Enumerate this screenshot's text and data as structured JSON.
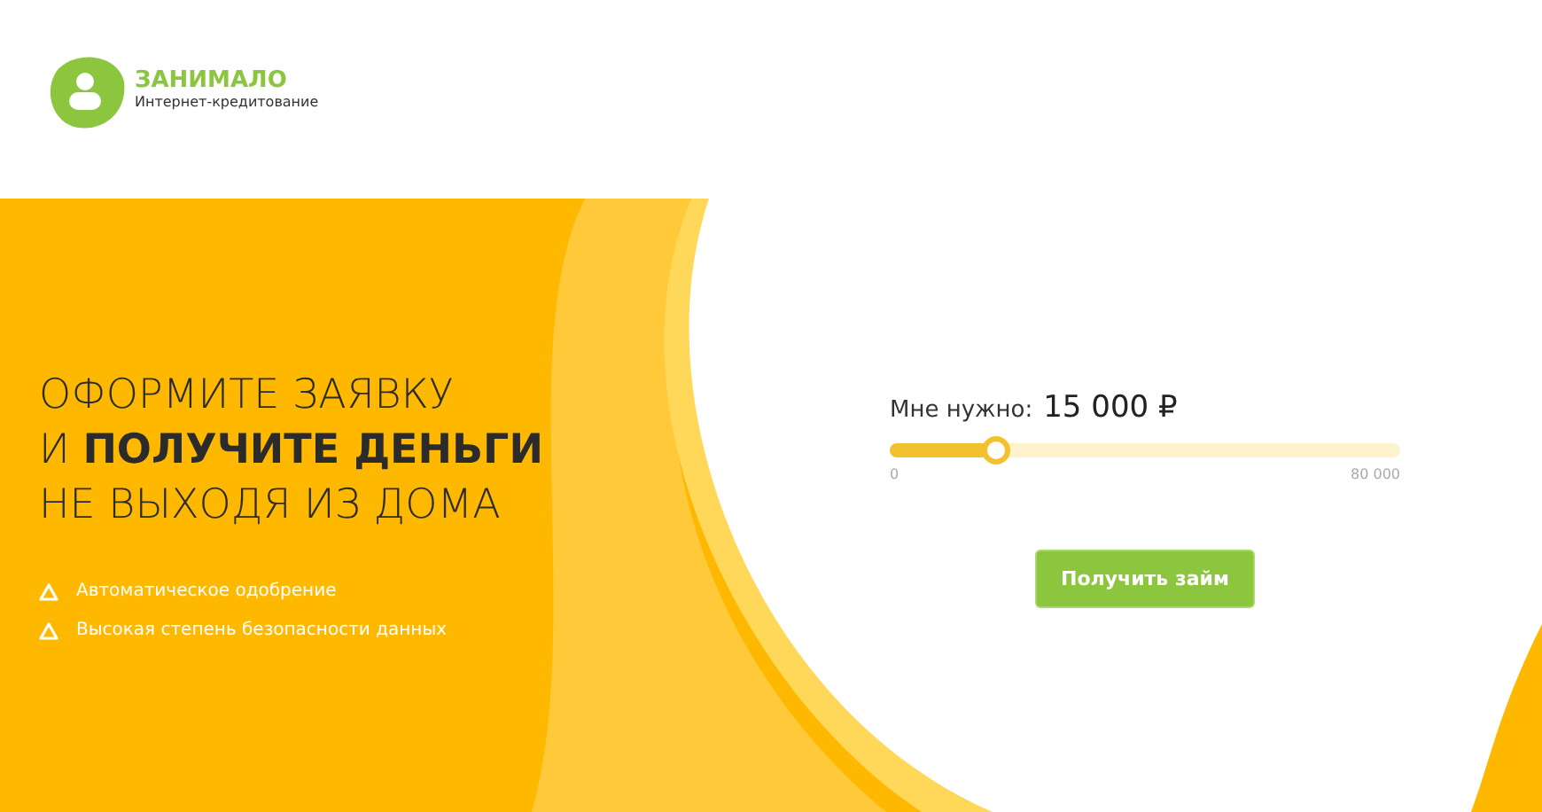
{
  "logo": {
    "name": "ЗАНИМАЛО",
    "tagline": "Интернет-кредитование"
  },
  "headline": [
    "ОФОРМИТЕ ЗАЯВКУ",
    "И **ПОЛУЧИТЕ ДЕНЬГИ**",
    "НЕ ВЫХОДЯ ИЗ ДОМА"
  ],
  "features": [
    "Автоматическое одобрение",
    "Высокая степень безопасности данных"
  ],
  "amount": {
    "label": "Мне нужно:",
    "value": "15 000 ₽",
    "level": 0.21,
    "min": "0",
    "max": "80 000"
  },
  "button": "Получить займ"
}
